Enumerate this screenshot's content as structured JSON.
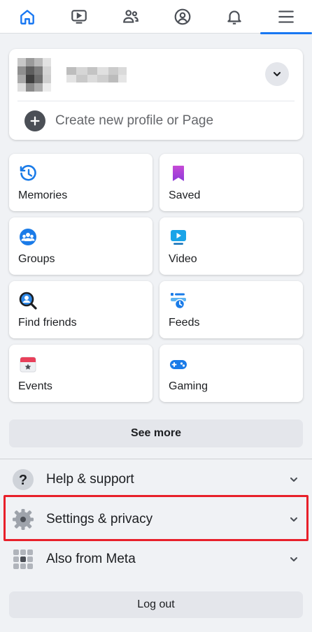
{
  "nav": {
    "tabs": [
      {
        "name": "home",
        "icon": "home-icon",
        "active": false
      },
      {
        "name": "watch",
        "icon": "video-icon",
        "active": false
      },
      {
        "name": "friends",
        "icon": "friends-icon",
        "active": false
      },
      {
        "name": "profile",
        "icon": "profile-icon",
        "active": false
      },
      {
        "name": "notifications",
        "icon": "bell-icon",
        "active": false
      },
      {
        "name": "menu",
        "icon": "hamburger-icon",
        "active": true
      }
    ],
    "accent": "#1877f2"
  },
  "profile": {
    "create_label": "Create new profile or Page"
  },
  "shortcuts": [
    {
      "label": "Memories",
      "icon": "memories-clock-icon"
    },
    {
      "label": "Saved",
      "icon": "saved-bookmark-icon"
    },
    {
      "label": "Groups",
      "icon": "groups-icon"
    },
    {
      "label": "Video",
      "icon": "video-play-icon"
    },
    {
      "label": "Find friends",
      "icon": "find-friends-icon"
    },
    {
      "label": "Feeds",
      "icon": "feeds-icon"
    },
    {
      "label": "Events",
      "icon": "events-calendar-icon"
    },
    {
      "label": "Gaming",
      "icon": "gaming-controller-icon"
    }
  ],
  "see_more_label": "See more",
  "menu": [
    {
      "label": "Help & support",
      "icon": "help-icon"
    },
    {
      "label": "Settings & privacy",
      "icon": "settings-gear-icon",
      "highlighted": true
    },
    {
      "label": "Also from Meta",
      "icon": "grid-apps-icon"
    }
  ],
  "logout_label": "Log out",
  "highlight_color": "#e8202a"
}
